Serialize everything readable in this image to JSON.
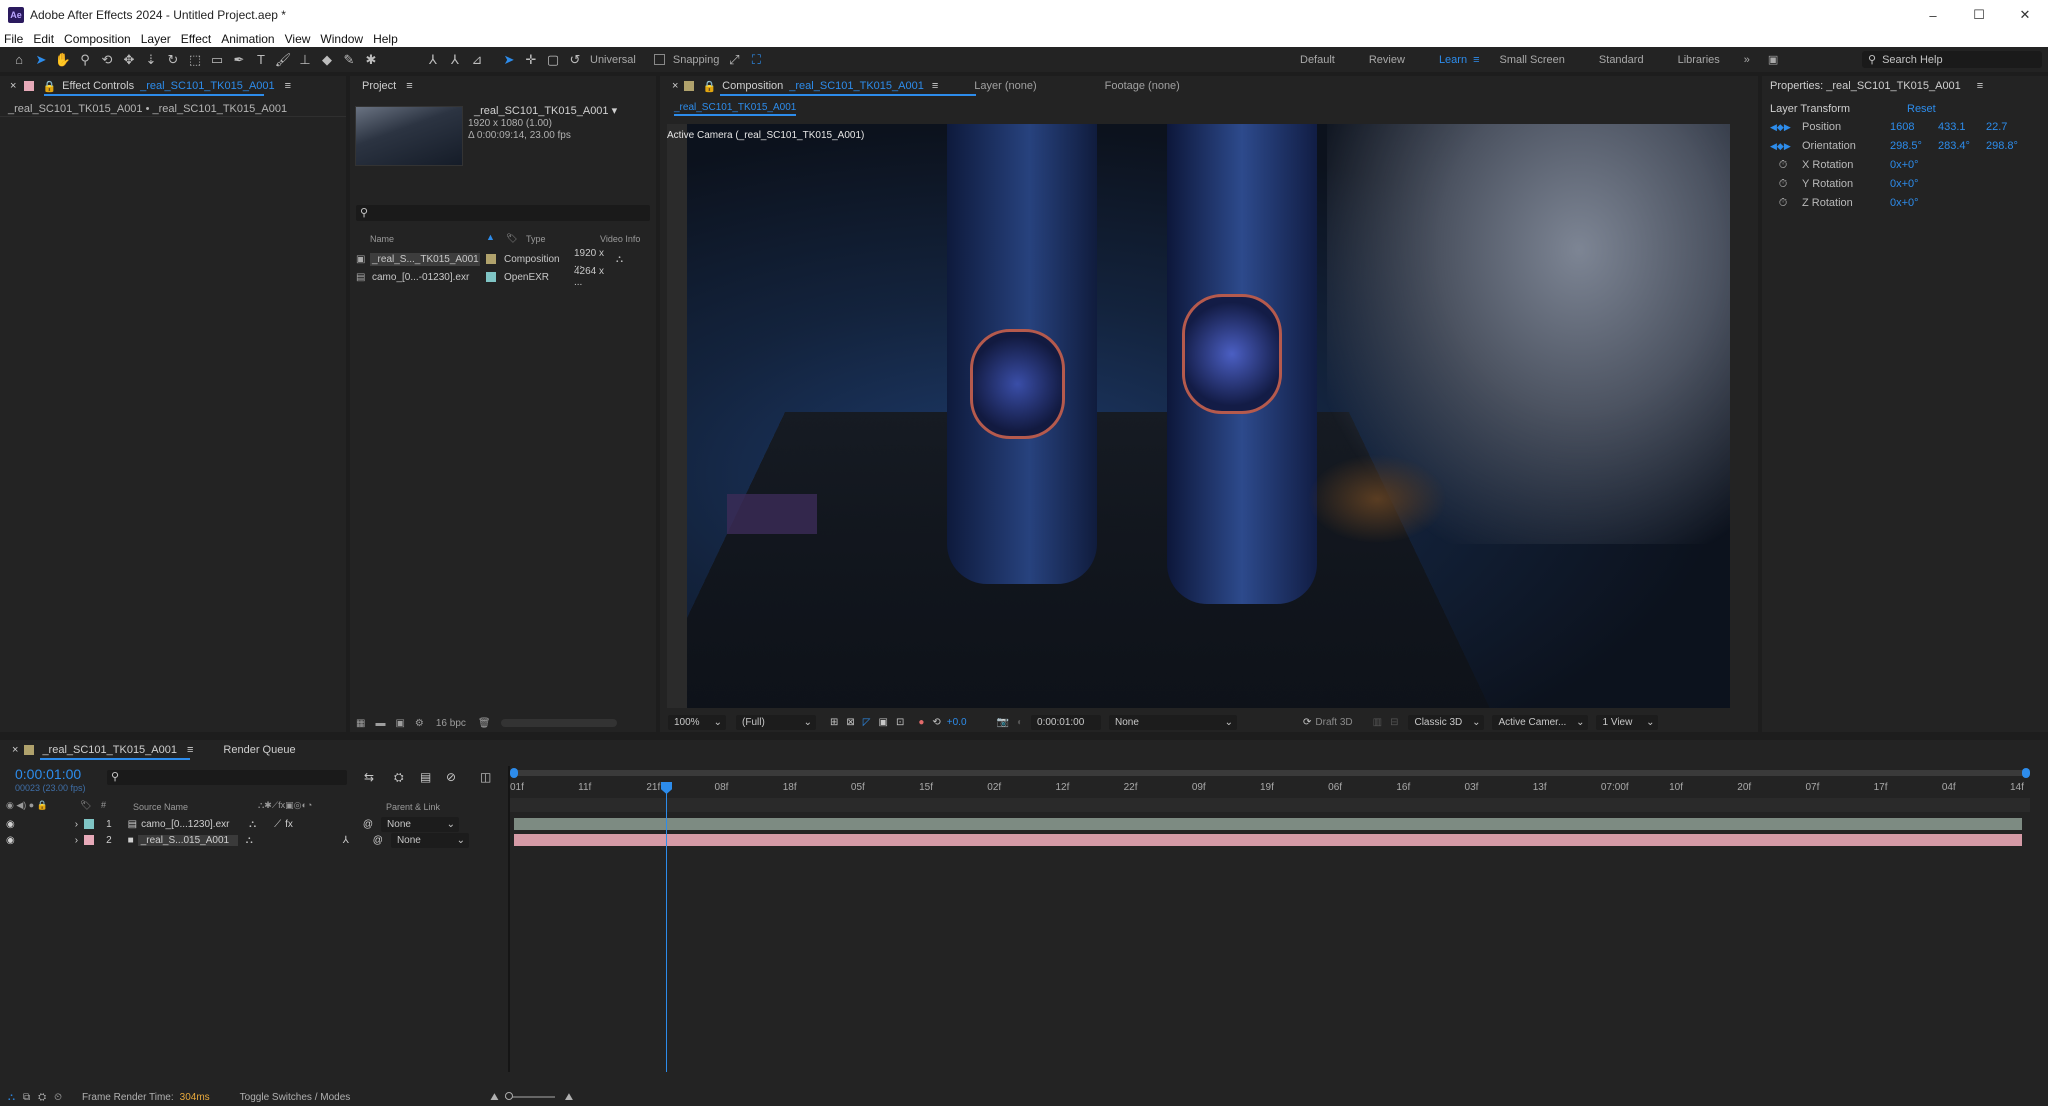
{
  "window": {
    "title": "Adobe After Effects 2024 - Untitled Project.aep *",
    "app_icon": "Ae",
    "buttons": [
      "–",
      "☐",
      "✕"
    ]
  },
  "menu": [
    "File",
    "Edit",
    "Composition",
    "Layer",
    "Effect",
    "Animation",
    "View",
    "Window",
    "Help"
  ],
  "toolbar": {
    "universal_label": "Universal",
    "snapping_label": "Snapping"
  },
  "workspaces": {
    "items": [
      "Default",
      "Review",
      "Learn",
      "Small Screen",
      "Standard",
      "Libraries"
    ],
    "active": "Learn",
    "search_placeholder": "Search Help"
  },
  "effect_controls": {
    "tab_label": "Effect Controls",
    "tab_comp": "_real_SC101_TK015_A001",
    "breadcrumb": "_real_SC101_TK015_A001 • _real_SC101_TK015_A001"
  },
  "project": {
    "tab_label": "Project",
    "thumb_name": "_real_SC101_TK015_A001",
    "thumb_res": "1920 x 1080 (1.00)",
    "thumb_dur": "Δ 0:00:09:14, 23.00 fps",
    "columns": {
      "name": "Name",
      "type": "Type",
      "video_info": "Video Info"
    },
    "items": [
      {
        "name": "_real_S..._TK015_A001",
        "type": "Composition",
        "info": "1920 x ...",
        "color": "#b0a26c"
      },
      {
        "name": "camo_[0...-01230].exr",
        "type": "OpenEXR",
        "info": "4264 x ...",
        "color": "#7fc4c4"
      }
    ],
    "bpc": "16 bpc"
  },
  "composition": {
    "tab_label": "Composition",
    "tab_comp": "_real_SC101_TK015_A001",
    "layer_tab": "Layer (none)",
    "footage_tab": "Footage (none)",
    "subtab": "_real_SC101_TK015_A001",
    "active_camera": "Active Camera (_real_SC101_TK015_A001)",
    "zoom": "100%",
    "resolution": "(Full)",
    "exposure": "+0.0",
    "timecode": "0:00:01:00",
    "channel": "None",
    "renderer": "Draft 3D",
    "renderer_mode": "Classic 3D",
    "camera": "Active Camer...",
    "views": "1 View"
  },
  "properties": {
    "title": "Properties: _real_SC101_TK015_A001",
    "section": "Layer Transform",
    "reset": "Reset",
    "rows": [
      {
        "label": "Position",
        "values": [
          "1608",
          "433.1",
          "22.7"
        ]
      },
      {
        "label": "Orientation",
        "values": [
          "298.5°",
          "283.4°",
          "298.8°"
        ]
      },
      {
        "label": "X Rotation",
        "values": [
          "0x+0°"
        ]
      },
      {
        "label": "Y Rotation",
        "values": [
          "0x+0°"
        ]
      },
      {
        "label": "Z Rotation",
        "values": [
          "0x+0°"
        ]
      }
    ]
  },
  "timeline": {
    "tab_label": "_real_SC101_TK015_A001",
    "render_queue": "Render Queue",
    "timecode": "0:00:01:00",
    "frame_info": "00023 (23.00 fps)",
    "col_source": "Source Name",
    "col_parent": "Parent & Link",
    "col_num": "#",
    "ruler": [
      "01f",
      "11f",
      "21f",
      "08f",
      "18f",
      "05f",
      "15f",
      "02f",
      "12f",
      "22f",
      "09f",
      "19f",
      "06f",
      "16f",
      "03f",
      "13f",
      "07:00f",
      "10f",
      "20f",
      "07f",
      "17f",
      "04f",
      "14f"
    ],
    "layers": [
      {
        "num": "1",
        "name": "camo_[0...1230].exr",
        "parent": "None",
        "color": "#7fc4c4",
        "bar_color": "#7d8b82"
      },
      {
        "num": "2",
        "name": "_real_S...015_A001",
        "parent": "None",
        "color": "#e6a9b8",
        "bar_color": "#d59aa6"
      }
    ],
    "footer_label": "Frame Render Time:",
    "footer_value": "304ms",
    "toggle_label": "Toggle Switches / Modes"
  }
}
